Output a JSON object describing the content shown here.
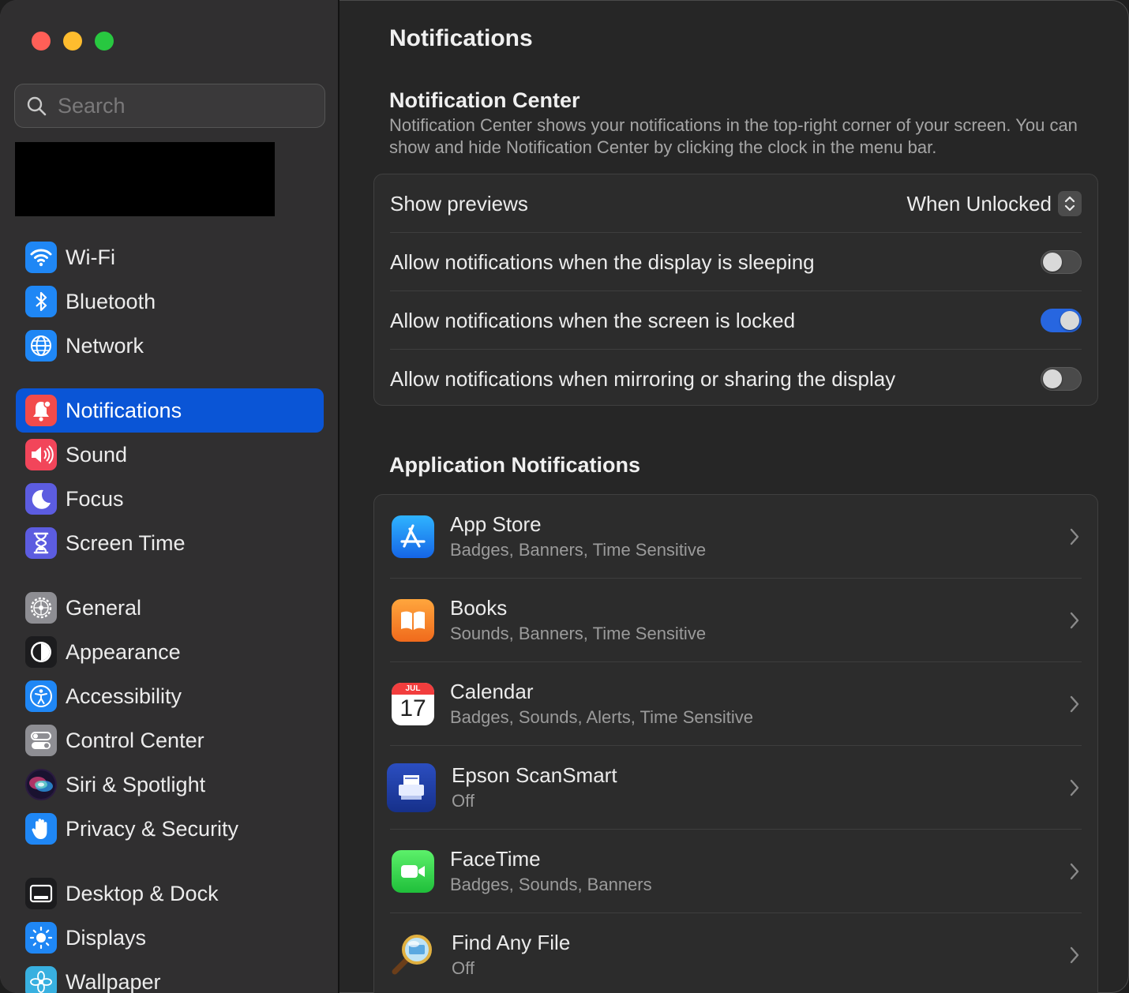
{
  "sidebar": {
    "search_placeholder": "Search",
    "items": [
      {
        "label": "Wi-Fi",
        "icon": "wifi-icon",
        "color": "#1f87f5"
      },
      {
        "label": "Bluetooth",
        "icon": "bluetooth-icon",
        "color": "#1f87f5"
      },
      {
        "label": "Network",
        "icon": "globe-icon",
        "color": "#1f87f5"
      },
      {
        "label": "Notifications",
        "icon": "bell-icon",
        "color": "#f24b4b"
      },
      {
        "label": "Sound",
        "icon": "speaker-icon",
        "color": "#f2455a"
      },
      {
        "label": "Focus",
        "icon": "moon-icon",
        "color": "#5c5ce0"
      },
      {
        "label": "Screen Time",
        "icon": "hourglass-icon",
        "color": "#5c5ce0"
      },
      {
        "label": "General",
        "icon": "gear-icon",
        "color": "#8e8e93"
      },
      {
        "label": "Appearance",
        "icon": "appearance-icon",
        "color": "#1c1c1e"
      },
      {
        "label": "Accessibility",
        "icon": "accessibility-icon",
        "color": "#1f87f5"
      },
      {
        "label": "Control Center",
        "icon": "control-center-icon",
        "color": "#8e8e93"
      },
      {
        "label": "Siri & Spotlight",
        "icon": "siri-icon",
        "color": "#3a1d5c"
      },
      {
        "label": "Privacy & Security",
        "icon": "hand-icon",
        "color": "#1f87f5"
      },
      {
        "label": "Desktop & Dock",
        "icon": "dock-icon",
        "color": "#1c1c1e"
      },
      {
        "label": "Displays",
        "icon": "sun-icon",
        "color": "#1f87f5"
      },
      {
        "label": "Wallpaper",
        "icon": "flower-icon",
        "color": "#38b0e0"
      }
    ]
  },
  "main": {
    "title": "Notifications",
    "notification_center": {
      "title": "Notification Center",
      "description": "Notification Center shows your notifications in the top-right corner of your screen. You can show and hide Notification Center by clicking the clock in the menu bar.",
      "show_previews_label": "Show previews",
      "show_previews_value": "When Unlocked",
      "toggles": [
        {
          "label": "Allow notifications when the display is sleeping",
          "on": false
        },
        {
          "label": "Allow notifications when the screen is locked",
          "on": true
        },
        {
          "label": "Allow notifications when mirroring or sharing the display",
          "on": false
        }
      ]
    },
    "app_notifications": {
      "title": "Application Notifications",
      "apps": [
        {
          "name": "App Store",
          "detail": "Badges, Banners, Time Sensitive",
          "icon": "app-store-icon"
        },
        {
          "name": "Books",
          "detail": "Sounds, Banners, Time Sensitive",
          "icon": "books-icon"
        },
        {
          "name": "Calendar",
          "detail": "Badges, Sounds, Alerts, Time Sensitive",
          "icon": "calendar-icon",
          "icon_month": "JUL",
          "icon_day": "17"
        },
        {
          "name": "Epson ScanSmart",
          "detail": "Off",
          "icon": "scanner-icon"
        },
        {
          "name": "FaceTime",
          "detail": "Badges, Sounds, Banners",
          "icon": "facetime-icon"
        },
        {
          "name": "Find Any File",
          "detail": "Off",
          "icon": "magnifier-icon"
        }
      ]
    }
  }
}
